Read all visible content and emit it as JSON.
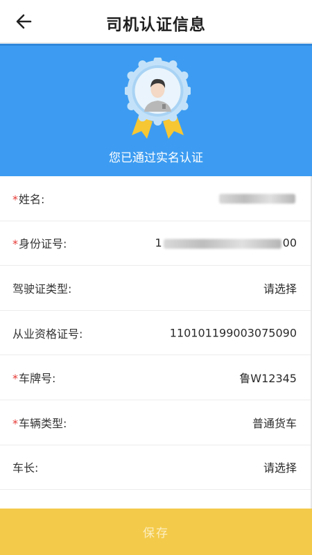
{
  "header": {
    "title": "司机认证信息",
    "back_icon": "back-arrow-icon"
  },
  "banner": {
    "badge_icon": "verified-avatar-badge-icon",
    "verified_text": "您已通过实名认证",
    "bg_color": "#3d9cf1"
  },
  "form": {
    "rows": [
      {
        "label": "姓名:",
        "required": true,
        "value": ""
      },
      {
        "label": "身份证号:",
        "required": true,
        "value_start": "1",
        "value_end": "00"
      },
      {
        "label": "驾驶证类型:",
        "required": false,
        "value": "请选择"
      },
      {
        "label": "从业资格证号:",
        "required": false,
        "value": "110101199003075090"
      },
      {
        "label": "车牌号:",
        "required": true,
        "value": "鲁W12345"
      },
      {
        "label": "车辆类型:",
        "required": true,
        "value": "普通货车"
      },
      {
        "label": "车长:",
        "required": false,
        "value": "请选择"
      }
    ],
    "required_mark": "*"
  },
  "footer": {
    "save_label": "保存",
    "save_color": "#f4ca4a"
  }
}
